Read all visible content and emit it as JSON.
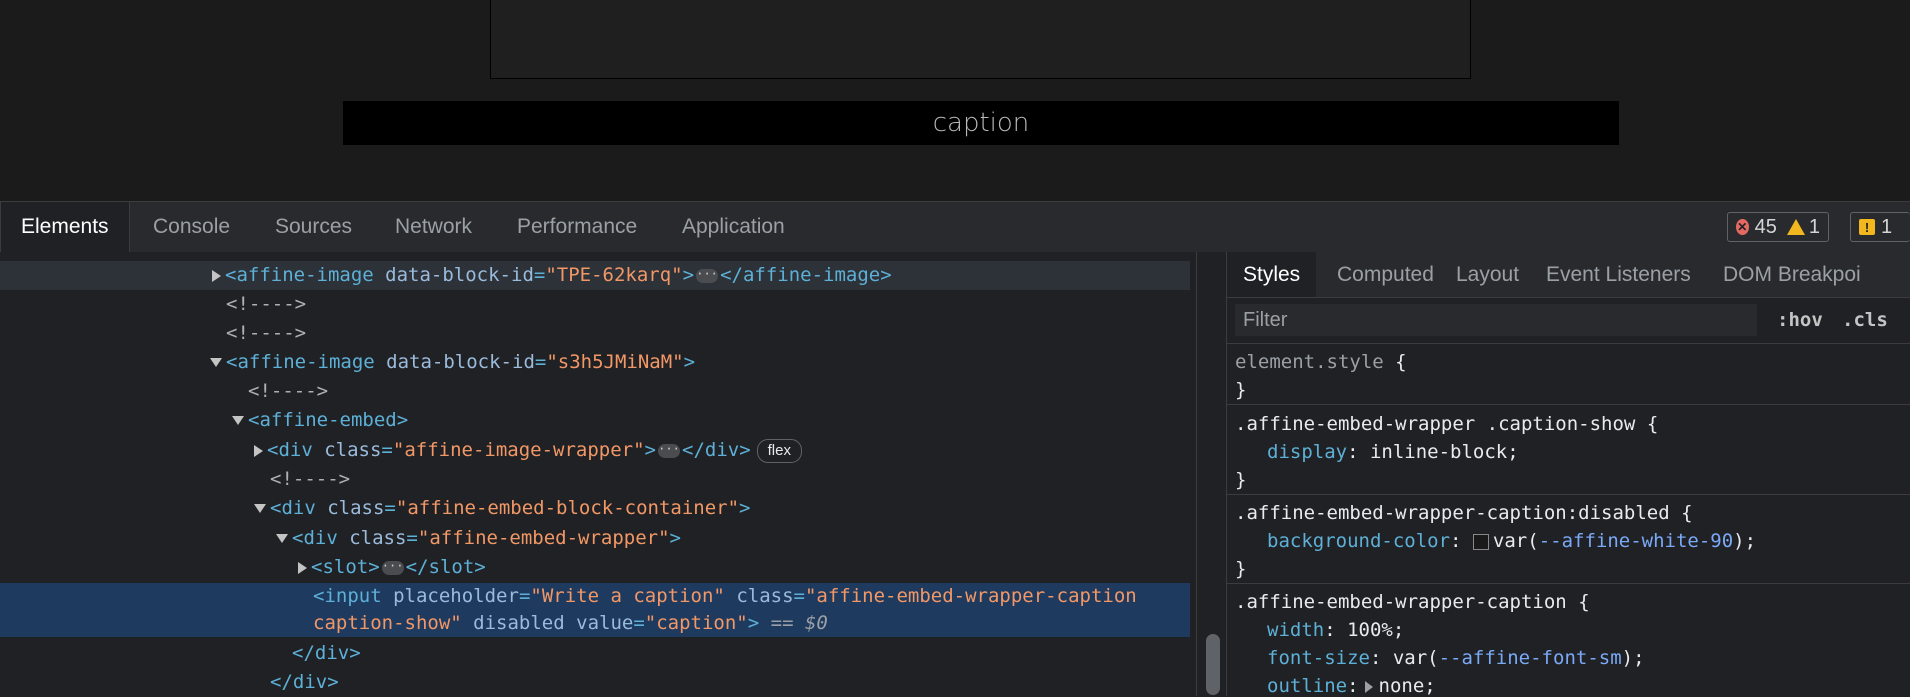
{
  "page": {
    "caption_text": "caption"
  },
  "devtools": {
    "tabs": [
      "Elements",
      "Console",
      "Sources",
      "Network",
      "Performance",
      "Application"
    ],
    "errors_count": "45",
    "warnings_count": "1",
    "issues_count": "1"
  },
  "elements": {
    "line1": {
      "tag_open": "<affine-image",
      "attr": "data-block-id",
      "val": "\"TPE-62karq\"",
      "close": ">",
      "end": "</affine-image>"
    },
    "comment": "<!---->",
    "line4": {
      "tag_open": "<affine-image",
      "attr": "data-block-id",
      "val": "\"s3h5JMiNaM\"",
      "close": ">"
    },
    "line6": {
      "tag": "<affine-embed>"
    },
    "line7": {
      "tag_open": "<div",
      "attr": "class",
      "val": "\"affine-image-wrapper\"",
      "close": ">",
      "end": "</div>",
      "badge": "flex"
    },
    "line9": {
      "tag_open": "<div",
      "attr": "class",
      "val": "\"affine-embed-block-container\"",
      "close": ">"
    },
    "line10": {
      "tag_open": "<div",
      "attr": "class",
      "val": "\"affine-embed-wrapper\"",
      "close": ">"
    },
    "line11": {
      "tag_open": "<slot>",
      "end": "</slot>"
    },
    "selected": {
      "tag_open": "<input",
      "attr1": "placeholder",
      "val1": "\"Write a caption\"",
      "attr2": "class",
      "val2": "\"affine-embed-wrapper-caption caption-show\"",
      "attr3": "disabled",
      "attr4": "value",
      "val4": "\"caption\"",
      "close": ">",
      "dollar": "== $0"
    },
    "close_div1": "</div>",
    "close_div2": "</div>"
  },
  "styles": {
    "tabs": [
      "Styles",
      "Computed",
      "Layout",
      "Event Listeners",
      "DOM Breakpoi"
    ],
    "filter_placeholder": "Filter",
    "hov": ":hov",
    "cls": ".cls",
    "rules": [
      {
        "selector": "element.style",
        "open": "{",
        "close": "}"
      },
      {
        "selector": ".affine-embed-wrapper .caption-show",
        "open": "{",
        "props": [
          {
            "name": "display",
            "value": "inline-block;"
          }
        ],
        "close": "}"
      },
      {
        "selector": ".affine-embed-wrapper-caption:disabled",
        "open": "{",
        "props": [
          {
            "name": "background-color",
            "prefix": "var(",
            "var": "--affine-white-90",
            "suffix": ");"
          }
        ],
        "close": "}"
      },
      {
        "selector": ".affine-embed-wrapper-caption",
        "open": "{",
        "props": [
          {
            "name": "width",
            "value": "100%;"
          },
          {
            "name": "font-size",
            "prefix": "var(",
            "var": "--affine-font-sm",
            "suffix": ");"
          },
          {
            "name": "outline",
            "value": "none;"
          }
        ]
      }
    ]
  },
  "colors": {
    "selected_row": "#1f3a5f",
    "tag": "#5db0d7",
    "attr_value": "#f29766",
    "error": "#e46962",
    "warning": "#f2b71f"
  }
}
